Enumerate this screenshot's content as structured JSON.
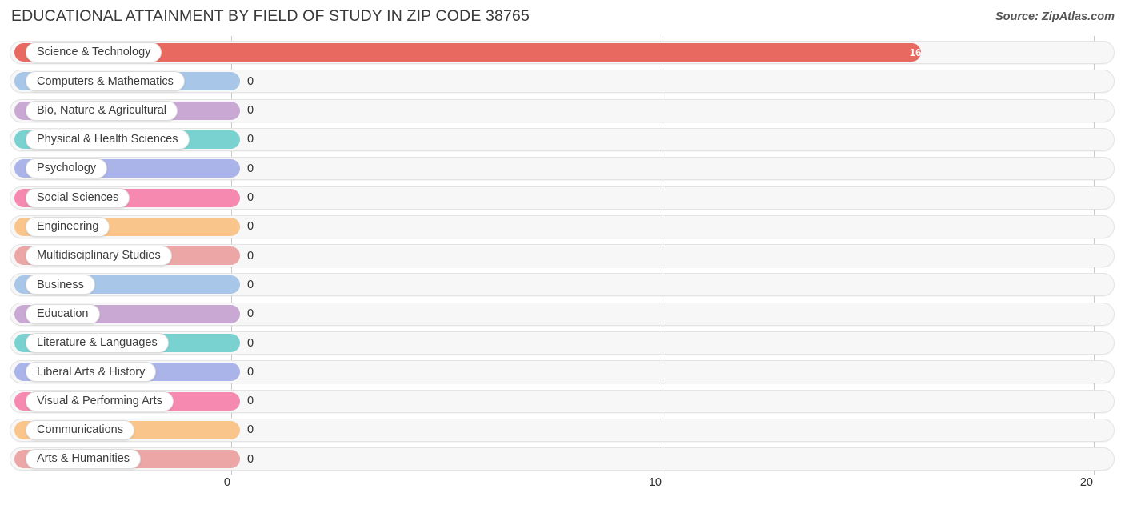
{
  "header": {
    "title": "EDUCATIONAL ATTAINMENT BY FIELD OF STUDY IN ZIP CODE 38765",
    "source": "Source: ZipAtlas.com"
  },
  "chart_data": {
    "type": "bar",
    "orientation": "horizontal",
    "title": "EDUCATIONAL ATTAINMENT BY FIELD OF STUDY IN ZIP CODE 38765",
    "xlabel": "",
    "ylabel": "",
    "xlim": [
      0,
      20
    ],
    "xticks": [
      0,
      10,
      20
    ],
    "xtick_labels": [
      "0",
      "10",
      "20"
    ],
    "grid": true,
    "legend": false,
    "categories": [
      "Science & Technology",
      "Computers & Mathematics",
      "Bio, Nature & Agricultural",
      "Physical & Health Sciences",
      "Psychology",
      "Social Sciences",
      "Engineering",
      "Multidisciplinary Studies",
      "Business",
      "Education",
      "Literature & Languages",
      "Liberal Arts & History",
      "Visual & Performing Arts",
      "Communications",
      "Arts & Humanities"
    ],
    "values": [
      16,
      0,
      0,
      0,
      0,
      0,
      0,
      0,
      0,
      0,
      0,
      0,
      0,
      0,
      0
    ],
    "value_labels": [
      "16",
      "0",
      "0",
      "0",
      "0",
      "0",
      "0",
      "0",
      "0",
      "0",
      "0",
      "0",
      "0",
      "0",
      "0"
    ],
    "colors": [
      "#e8695f",
      "#a8c6e8",
      "#c9a8d4",
      "#79d2d0",
      "#aab4e8",
      "#f589b0",
      "#fac58a",
      "#eda6a6",
      "#a8c6e8",
      "#c9a8d4",
      "#79d2d0",
      "#aab4e8",
      "#f589b0",
      "#fac58a",
      "#eda6a6"
    ]
  }
}
